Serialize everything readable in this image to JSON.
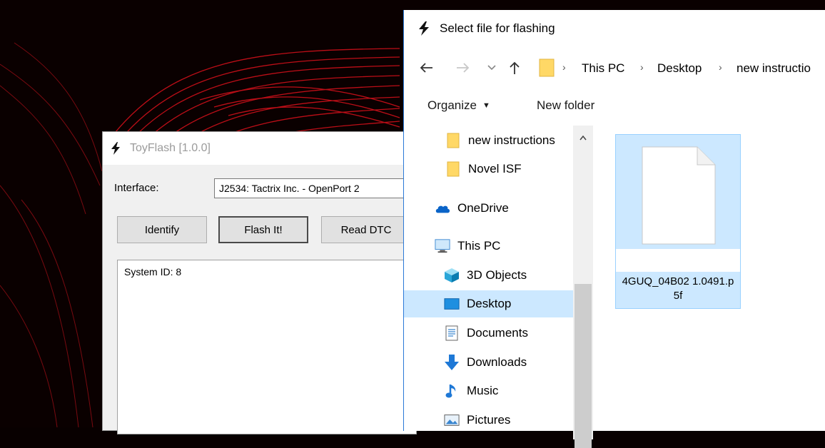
{
  "toyflash": {
    "title": "ToyFlash [1.0.0]",
    "interface_label": "Interface:",
    "interface_value": "J2534: Tactrix Inc. - OpenPort 2",
    "buttons": {
      "identify": "Identify",
      "flash": "Flash It!",
      "read_dtc": "Read DTC"
    },
    "log_line": "System ID: 8"
  },
  "dialog": {
    "title": "Select file for flashing",
    "breadcrumb": [
      "This PC",
      "Desktop",
      "new instructio"
    ],
    "breadcrumb_sep": "›",
    "toolbar": {
      "organize": "Organize",
      "new_folder": "New folder"
    },
    "nav": [
      {
        "label": "new instructions",
        "icon": "folder-icon"
      },
      {
        "label": "Novel ISF",
        "icon": "folder-icon"
      },
      {
        "label": "OneDrive",
        "icon": "onedrive-icon"
      },
      {
        "label": "This PC",
        "icon": "pc-icon"
      },
      {
        "label": "3D Objects",
        "icon": "3d-objects-icon"
      },
      {
        "label": "Desktop",
        "icon": "desktop-icon",
        "selected": true
      },
      {
        "label": "Documents",
        "icon": "documents-icon"
      },
      {
        "label": "Downloads",
        "icon": "downloads-icon"
      },
      {
        "label": "Music",
        "icon": "music-icon"
      },
      {
        "label": "Pictures",
        "icon": "pictures-icon"
      }
    ],
    "files": [
      {
        "name": "4GUQ_04B02 1.0491.p5f",
        "selected": true
      }
    ]
  },
  "colors": {
    "accent": "#0078d7",
    "selection": "#cce8ff",
    "folder": "#ffd866",
    "desktop_red": "#e0141e"
  }
}
